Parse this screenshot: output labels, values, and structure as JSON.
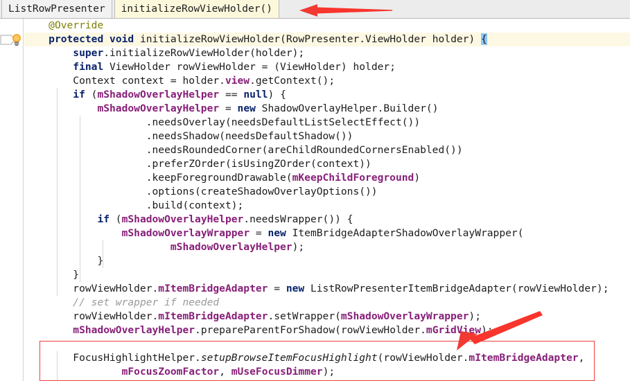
{
  "breadcrumb": {
    "items": [
      {
        "label": "ListRowPresenter",
        "kind": "class"
      },
      {
        "label": "initializeRowViewHolder()",
        "kind": "method"
      }
    ]
  },
  "editor": {
    "gutter": {
      "fold_icon": "fold-collapse-arrow-icon",
      "hint_icon": "lightbulb-intention-icon"
    },
    "code_lines": [
      {
        "indent": "    ",
        "text": "@Override"
      },
      {
        "indent": "    ",
        "text": "protected void initializeRowViewHolder(RowPresenter.ViewHolder holder) {"
      },
      {
        "indent": "        ",
        "text": "super.initializeRowViewHolder(holder);"
      },
      {
        "indent": "        ",
        "text": "final ViewHolder rowViewHolder = (ViewHolder) holder;"
      },
      {
        "indent": "        ",
        "text": "Context context = holder.view.getContext();"
      },
      {
        "indent": "        ",
        "text": "if (mShadowOverlayHelper == null) {"
      },
      {
        "indent": "            ",
        "text": "mShadowOverlayHelper = new ShadowOverlayHelper.Builder()"
      },
      {
        "indent": "                    ",
        "text": ".needsOverlay(needsDefaultListSelectEffect())"
      },
      {
        "indent": "                    ",
        "text": ".needsShadow(needsDefaultShadow())"
      },
      {
        "indent": "                    ",
        "text": ".needsRoundedCorner(areChildRoundedCornersEnabled())"
      },
      {
        "indent": "                    ",
        "text": ".preferZOrder(isUsingZOrder(context))"
      },
      {
        "indent": "                    ",
        "text": ".keepForegroundDrawable(mKeepChildForeground)"
      },
      {
        "indent": "                    ",
        "text": ".options(createShadowOverlayOptions())"
      },
      {
        "indent": "                    ",
        "text": ".build(context);"
      },
      {
        "indent": "            ",
        "text": "if (mShadowOverlayHelper.needsWrapper()) {"
      },
      {
        "indent": "                ",
        "text": "mShadowOverlayWrapper = new ItemBridgeAdapterShadowOverlayWrapper("
      },
      {
        "indent": "                        ",
        "text": "mShadowOverlayHelper);"
      },
      {
        "indent": "            ",
        "text": "}"
      },
      {
        "indent": "        ",
        "text": "}"
      },
      {
        "indent": "        ",
        "text": "rowViewHolder.mItemBridgeAdapter = new ListRowPresenterItemBridgeAdapter(rowViewHolder);"
      },
      {
        "indent": "        ",
        "text": "// set wrapper if needed"
      },
      {
        "indent": "        ",
        "text": "rowViewHolder.mItemBridgeAdapter.setWrapper(mShadowOverlayWrapper);"
      },
      {
        "indent": "        ",
        "text": "mShadowOverlayHelper.prepareParentForShadow(rowViewHolder.mGridView);"
      },
      {
        "indent": "",
        "text": ""
      },
      {
        "indent": "        ",
        "text": "FocusHighlightHelper.setupBrowseItemFocusHighlight(rowViewHolder.mItemBridgeAdapter,"
      },
      {
        "indent": "                ",
        "text": "mFocusZoomFactor, mUseFocusDimmer);"
      }
    ]
  },
  "annotations": {
    "arrows": [
      {
        "name": "breadcrumb-method-arrow",
        "direction": "left",
        "color": "#f03a32"
      },
      {
        "name": "focus-highlight-call-arrow",
        "direction": "down-left",
        "color": "#f03a32"
      }
    ],
    "highlight_box": {
      "name": "focus-highlight-callout-box",
      "color": "#e8413c"
    }
  },
  "colors": {
    "keyword": "#0a246a",
    "field": "#871f78",
    "annotation": "#808000",
    "comment": "#9a9a9a",
    "plain": "#1c1c1c",
    "caret_line_bg": "#fdf8e3",
    "breadcrumb_bg": "#ececec",
    "accent_red": "#e8413c"
  }
}
